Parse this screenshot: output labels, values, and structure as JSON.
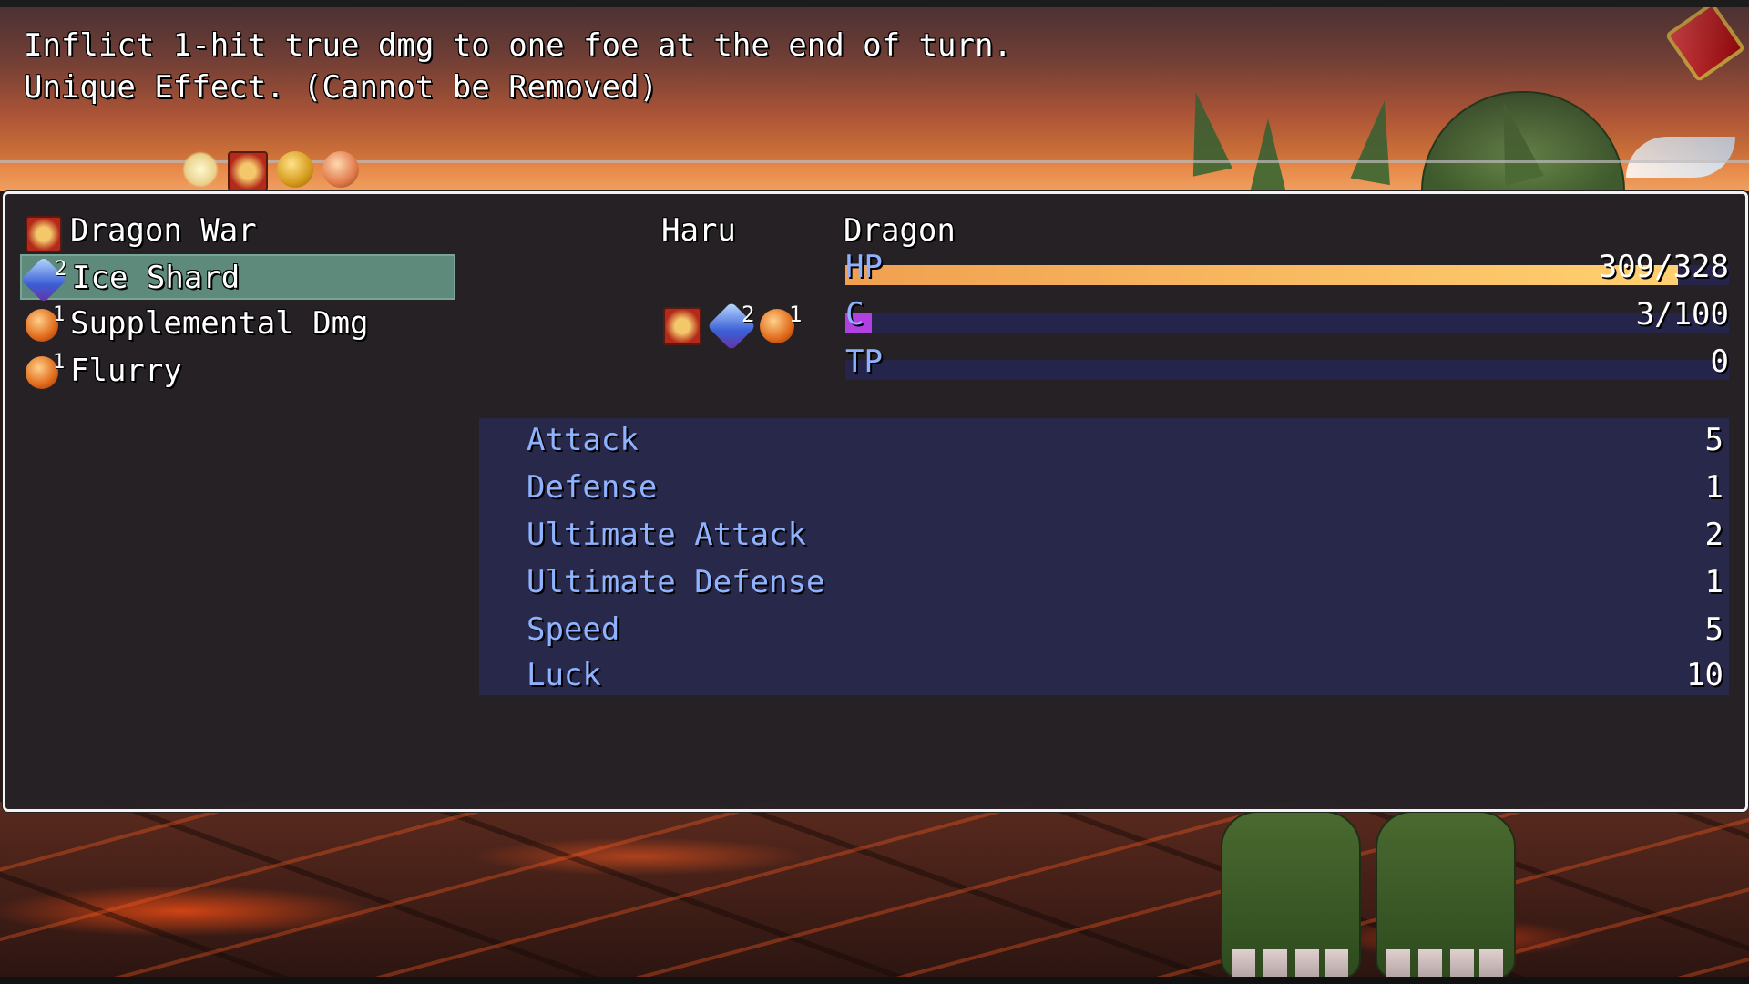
{
  "description": {
    "line1": "Inflict 1-hit true dmg to one foe at the end of turn.",
    "line2": "Unique Effect. (Cannot be Removed)"
  },
  "status_icons": [
    "star-icon",
    "dragon-war-icon",
    "shield-icon",
    "wind-icon"
  ],
  "status_list": [
    {
      "label": "Dragon War",
      "icon": "dragon-war-icon",
      "stacks": ""
    },
    {
      "label": "Ice Shard",
      "icon": "ice-shard-icon",
      "stacks": "2",
      "selected": true
    },
    {
      "label": "Supplemental Dmg",
      "icon": "orb-icon",
      "stacks": "1"
    },
    {
      "label": "Flurry",
      "icon": "orb-icon",
      "stacks": "1"
    }
  ],
  "actor": {
    "name": "Haru",
    "applied_icons": [
      {
        "icon": "dragon-war-icon",
        "stacks": ""
      },
      {
        "icon": "ice-shard-icon",
        "stacks": "2"
      },
      {
        "icon": "orb-icon",
        "stacks": "1"
      }
    ]
  },
  "target": {
    "name": "Dragon",
    "hp": {
      "label": "HP",
      "value": "309/328",
      "current": 309,
      "max": 328,
      "color": "#f0a050"
    },
    "c": {
      "label": "C",
      "value": "3/100",
      "current": 3,
      "max": 100,
      "color": "#b040e0"
    },
    "tp": {
      "label": "TP",
      "value": "0",
      "current": 0,
      "max": 100,
      "color": "#60c060"
    }
  },
  "stats": [
    {
      "name": "Attack",
      "value": "5"
    },
    {
      "name": "Defense",
      "value": "1"
    },
    {
      "name": "Ultimate Attack",
      "value": "2"
    },
    {
      "name": "Ultimate Defense",
      "value": "1"
    },
    {
      "name": "Speed",
      "value": "5"
    },
    {
      "name": "Luck",
      "value": "10"
    }
  ],
  "colors": {
    "selection": "#5d8a7a",
    "stat_label": "#8fb2ff",
    "panel_bg": "#262226"
  }
}
